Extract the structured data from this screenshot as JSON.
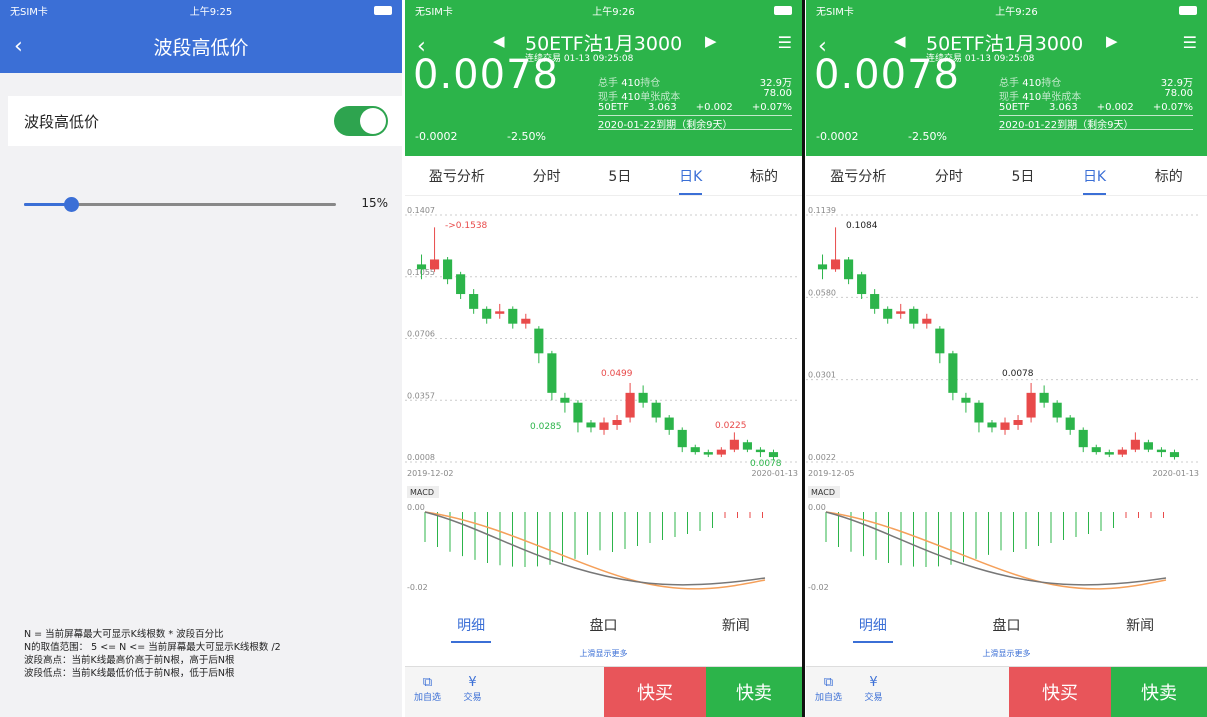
{
  "phone1": {
    "status": {
      "carrier": "无SIM卡",
      "time": "上午9:25"
    },
    "nav_title": "波段高低价",
    "setting_label": "波段高低价",
    "toggle_on": true,
    "slider_value_label": "15%",
    "slider_fraction": 0.15,
    "notes": [
      "N = 当前屏幕最大可显示K线根数 * 波段百分比",
      "N的取值范围： 5 <= N <= 当前屏幕最大可显示K线根数 /2",
      "波段高点：当前K线最高价高于前N根，高于后N根",
      "波段低点：当前K线最低价低于前N根，低于后N根"
    ]
  },
  "trade": {
    "status": {
      "carrier": "无SIM卡",
      "time": "上午9:26"
    },
    "symbol": "50ETF沽1月3000",
    "subtitle": "连续交易 01-13 09:25:08",
    "price": "0.0078",
    "change": "-0.0002",
    "change_pct": "-2.50%",
    "stats": [
      {
        "k1": "总手",
        "v1": "410",
        "k2": "持仓",
        "v2": "32.9万"
      },
      {
        "k1": "现手",
        "v1": "410",
        "k2": "单张成本",
        "v2": "78.00"
      }
    ],
    "underlying": {
      "name": "50ETF",
      "price": "3.063",
      "chg": "+0.002",
      "pct": "+0.07%"
    },
    "expiry": "2020-01-22到期（剩余9天）",
    "tabs": [
      "盈亏分析",
      "分时",
      "5日",
      "日K",
      "标的"
    ],
    "active_tab": "日K",
    "bottom_tabs": [
      "明细",
      "盘口",
      "新闻"
    ],
    "more_text": "上滑显示更多",
    "btn_watch": "加自选",
    "btn_trade": "交易",
    "buy": "快买",
    "sell": "快卖",
    "macd_label": "MACD",
    "macd_max": "0.00",
    "macd_min": "-0.02"
  },
  "chart_data": [
    {
      "type": "candlestick",
      "y_ticks": [
        "0.1407",
        "0.1055",
        "0.0706",
        "0.0357",
        "0.0008"
      ],
      "x_start": "2019-12-02",
      "x_end": "2020-01-13",
      "annotations": [
        {
          "text": "->0.1538",
          "color": "#e84a4a"
        },
        {
          "text": "0.0499",
          "color": "#e84a4a"
        },
        {
          "text": "0.0225",
          "color": "#e84a4a"
        },
        {
          "text": "0.0285",
          "color": "#2cb44a"
        },
        {
          "text": "0.0078",
          "color": "#2cb44a"
        }
      ]
    },
    {
      "type": "candlestick",
      "y_ticks": [
        "0.1139",
        "0.0580",
        "0.0301",
        "0.0022"
      ],
      "x_start": "2019-12-05",
      "x_end": "2020-01-13",
      "annotations": [
        {
          "text": "0.1084",
          "color": "#222"
        },
        {
          "text": "0.0078",
          "color": "#222"
        }
      ]
    }
  ]
}
